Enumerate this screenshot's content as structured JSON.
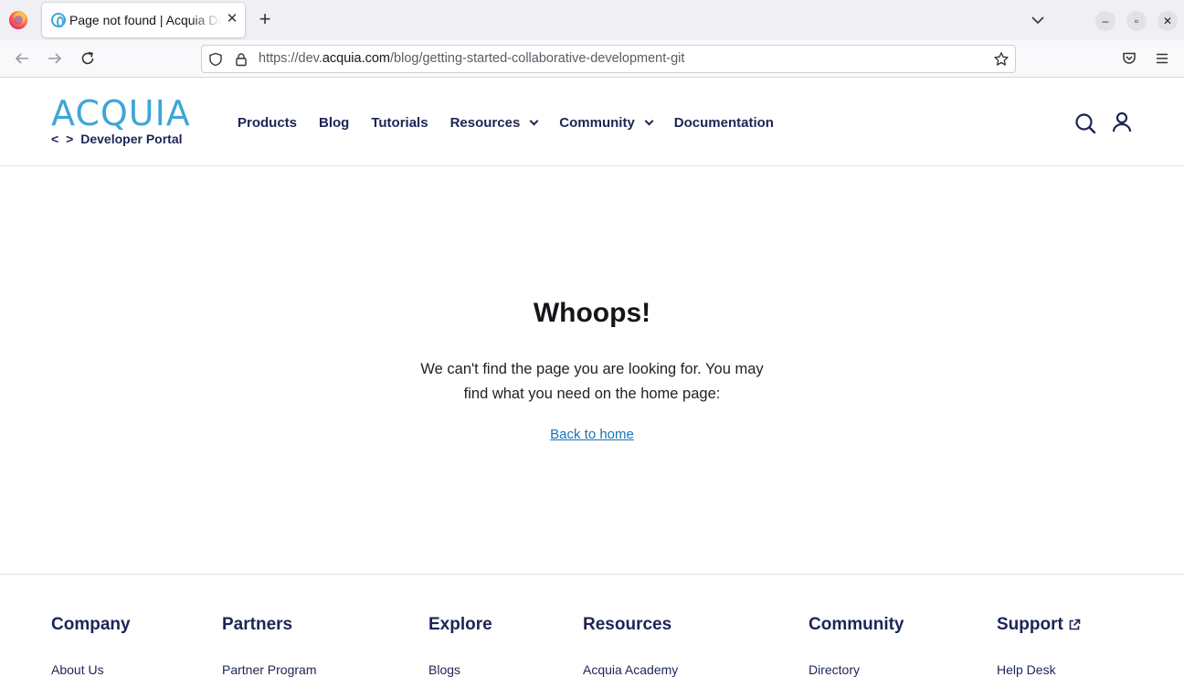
{
  "browser": {
    "tab_title": "Page not found | Acquia Developer Portal",
    "tab_close": "✕",
    "new_tab": "+",
    "url_prefix": "https://dev.",
    "url_host": "acquia.com",
    "url_path": "/blog/getting-started-collaborative-development-git",
    "window_controls": {
      "minimize": "–",
      "restore": "▫",
      "close": "✕"
    }
  },
  "header": {
    "logo_word": "ACQUIA",
    "logo_code": "< >",
    "logo_sub": "Developer Portal",
    "menu": [
      {
        "label": "Products",
        "dropdown": false
      },
      {
        "label": "Blog",
        "dropdown": false
      },
      {
        "label": "Tutorials",
        "dropdown": false
      },
      {
        "label": "Resources",
        "dropdown": true
      },
      {
        "label": "Community",
        "dropdown": true
      },
      {
        "label": "Documentation",
        "dropdown": false
      }
    ],
    "icons": [
      "search-icon",
      "user-icon"
    ]
  },
  "main": {
    "headline": "Whoops!",
    "message": "We can't find the page you are looking for. You may find what you need on the home page:",
    "back_link": "Back to home"
  },
  "footer": {
    "columns": [
      {
        "heading": "Company",
        "first_link": "About Us"
      },
      {
        "heading": "Partners",
        "first_link": "Partner Program"
      },
      {
        "heading": "Explore",
        "first_link": "Blogs"
      },
      {
        "heading": "Resources",
        "first_link": "Acquia Academy"
      },
      {
        "heading": "Community",
        "first_link": "Directory"
      },
      {
        "heading": "Support",
        "first_link": "Help Desk"
      }
    ]
  },
  "colors": {
    "brand_blue": "#3ea6d6",
    "navy": "#1d2555",
    "link": "#1a74b8"
  }
}
